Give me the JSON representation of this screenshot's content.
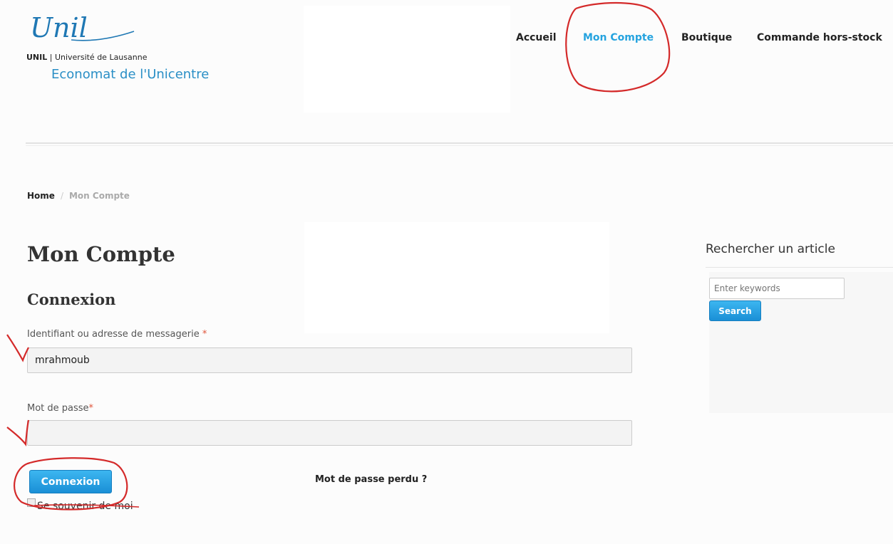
{
  "logo": {
    "script_text": "Unil",
    "org_short": "UNIL",
    "org_full": "Université de Lausanne",
    "department": "Economat de l'Unicentre"
  },
  "nav": {
    "items": [
      {
        "label": "Accueil",
        "active": false
      },
      {
        "label": "Mon Compte",
        "active": true
      },
      {
        "label": "Boutique",
        "active": false
      },
      {
        "label": "Commande hors-stock",
        "active": false
      }
    ]
  },
  "breadcrumb": {
    "home": "Home",
    "separator": "/",
    "current": "Mon Compte"
  },
  "page": {
    "title": "Mon Compte",
    "section": "Connexion"
  },
  "login_form": {
    "username_label": "Identifiant ou adresse de messagerie",
    "required_mark": "*",
    "username_value": "mrahmoub",
    "password_label": "Mot de passe",
    "password_value": "",
    "submit_label": "Connexion",
    "lost_password": "Mot de passe perdu ?",
    "remember_label": "Se souvenir de moi",
    "remember_checked": false
  },
  "sidebar": {
    "search_title": "Rechercher un article",
    "search_placeholder": "Enter keywords",
    "search_button": "Search"
  },
  "colors": {
    "accent": "#25a3df",
    "button": "#1a8fd6",
    "required": "#e0543a",
    "annotation": "#d42a2a"
  }
}
